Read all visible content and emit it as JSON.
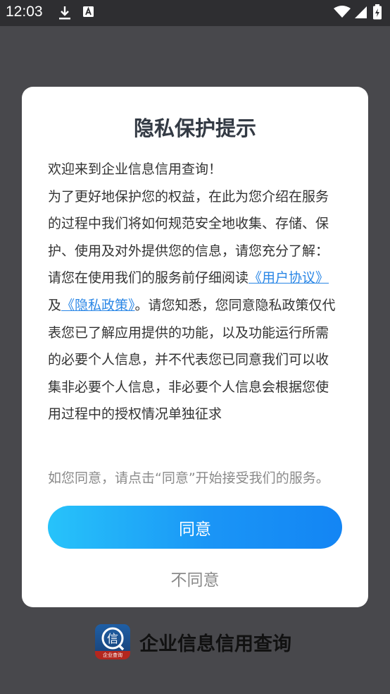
{
  "status_bar": {
    "time": "12:03",
    "left_icons": [
      "download-icon",
      "a-app-icon"
    ],
    "right_icons": [
      "wifi-icon",
      "cellular-signal-icon",
      "battery-icon"
    ]
  },
  "dialog": {
    "title": "隐私保护提示",
    "intro_lines": [
      "欢迎来到企业信息信用查询！",
      "为了更好地保护您的权益，在此为您介绍在服务的过程中我们将如何规范安全地收集、存储、保护、使用及对外提供您的信息，请您充分了解："
    ],
    "policy_prefix": "请您在使用我们的服务前仔细阅读",
    "user_agreement_link": "《用户协议》",
    "conjunction": "及",
    "privacy_policy_link": "《隐私政策》",
    "policy_suffix": "。请您知悉，您同意隐私政策仅代表您已了解应用提供的功能，以及功能运行所需的必要个人信息，并不代表您已同意我们可以收集非必要个人信息，非必要个人信息会根据您使用过程中的授权情况单独征求",
    "hint": "如您同意，请点击“同意”开始接受我们的服务。",
    "agree_label": "同意",
    "disagree_label": "不同意"
  },
  "app": {
    "name": "企业信息信用查询",
    "logo_char": "信",
    "logo_caption": "企业查询"
  },
  "colors": {
    "link": "#2b87e6",
    "agree_gradient_start": "#27c3fa",
    "agree_gradient_end": "#1385f4",
    "title": "#333a44"
  }
}
